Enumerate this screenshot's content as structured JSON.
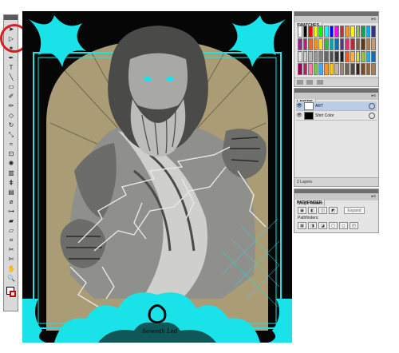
{
  "tools_panel": {
    "icons": [
      "selection-icon",
      "direct-selection-icon",
      "magic-wand-icon",
      "pen-icon",
      "type-icon",
      "line-icon",
      "rectangle-icon",
      "paintbrush-icon",
      "pencil-icon",
      "eraser-icon",
      "rotate-icon",
      "scale-icon",
      "warp-icon",
      "free-transform-icon",
      "symbol-sprayer-icon",
      "column-graph-icon",
      "mesh-icon",
      "gradient-icon",
      "eyedropper-icon",
      "blend-icon",
      "live-paint-icon",
      "live-paint-selection-icon",
      "crop-icon",
      "slice-icon",
      "scissors-icon",
      "hand-icon",
      "zoom-icon"
    ],
    "glyphs": [
      "➤",
      "▷",
      "✶",
      "✒",
      "T",
      "╲",
      "▭",
      "✐",
      "✏",
      "◇",
      "↻",
      "⤡",
      "≈",
      "⊡",
      "✺",
      "▥",
      "⋕",
      "▤",
      "⌀",
      "⊶",
      "▰",
      "▱",
      "⌗",
      "✂",
      "✄",
      "✋",
      "🔍"
    ]
  },
  "artwork": {
    "signature": "Seventh Led",
    "colors": {
      "background": "#060606",
      "accent": "#19e3e8",
      "gold": "#c8b88a",
      "stone_light": "#cfcfcb",
      "stone_mid": "#8f8f8c",
      "stone_dark": "#4a4a48"
    }
  },
  "swatches_panel": {
    "tab": "SWATCHES",
    "menu": "▸≡",
    "colors": [
      "#ffffff",
      "#000000",
      "#ff0000",
      "#ffff00",
      "#00ff00",
      "#00ffff",
      "#0000ff",
      "#ff00ff",
      "#ed1c24",
      "#f7941d",
      "#fff200",
      "#8dc63f",
      "#00a651",
      "#00aeef",
      "#2e3192",
      "#92278f",
      "#ec008c",
      "#f26522",
      "#f7941d",
      "#ffde17",
      "#39b54a",
      "#00a99d",
      "#0072bc",
      "#662d91",
      "#ee2a7b",
      "#c1272d",
      "#8b5e3c",
      "#603913",
      "#a67c52",
      "#c69c6d",
      "#e6e6e6",
      "#cccccc",
      "#b3b3b3",
      "#999999",
      "#808080",
      "#666666",
      "#4d4d4d",
      "#333333",
      "#1a1a1a",
      "#f15a24",
      "#fbb03b",
      "#d9e021",
      "#8cc63f",
      "#29abe2",
      "#0071bc",
      "#9e005d",
      "#d4145a",
      "#ff7bac",
      "#7ac943",
      "#3fa9f5",
      "#ff931e",
      "#ffcc00",
      "#c7b299",
      "#998675",
      "#736357",
      "#534741",
      "#42210b",
      "#754c24",
      "#8c6239",
      "#a67c52"
    ]
  },
  "layers_panel": {
    "tab": "LAYERS",
    "menu": "▸≡",
    "layers": [
      {
        "name": "ART",
        "selected": true
      },
      {
        "name": "Shirt Color",
        "selected": false
      }
    ],
    "footer": "2 Layers"
  },
  "pathfinder_panel": {
    "tab": "PATHFINDER",
    "menu": "▸≡",
    "shape_modes_label": "Shape Modes:",
    "expand_label": "Expand",
    "pathfinders_label": "Pathfinders:"
  }
}
